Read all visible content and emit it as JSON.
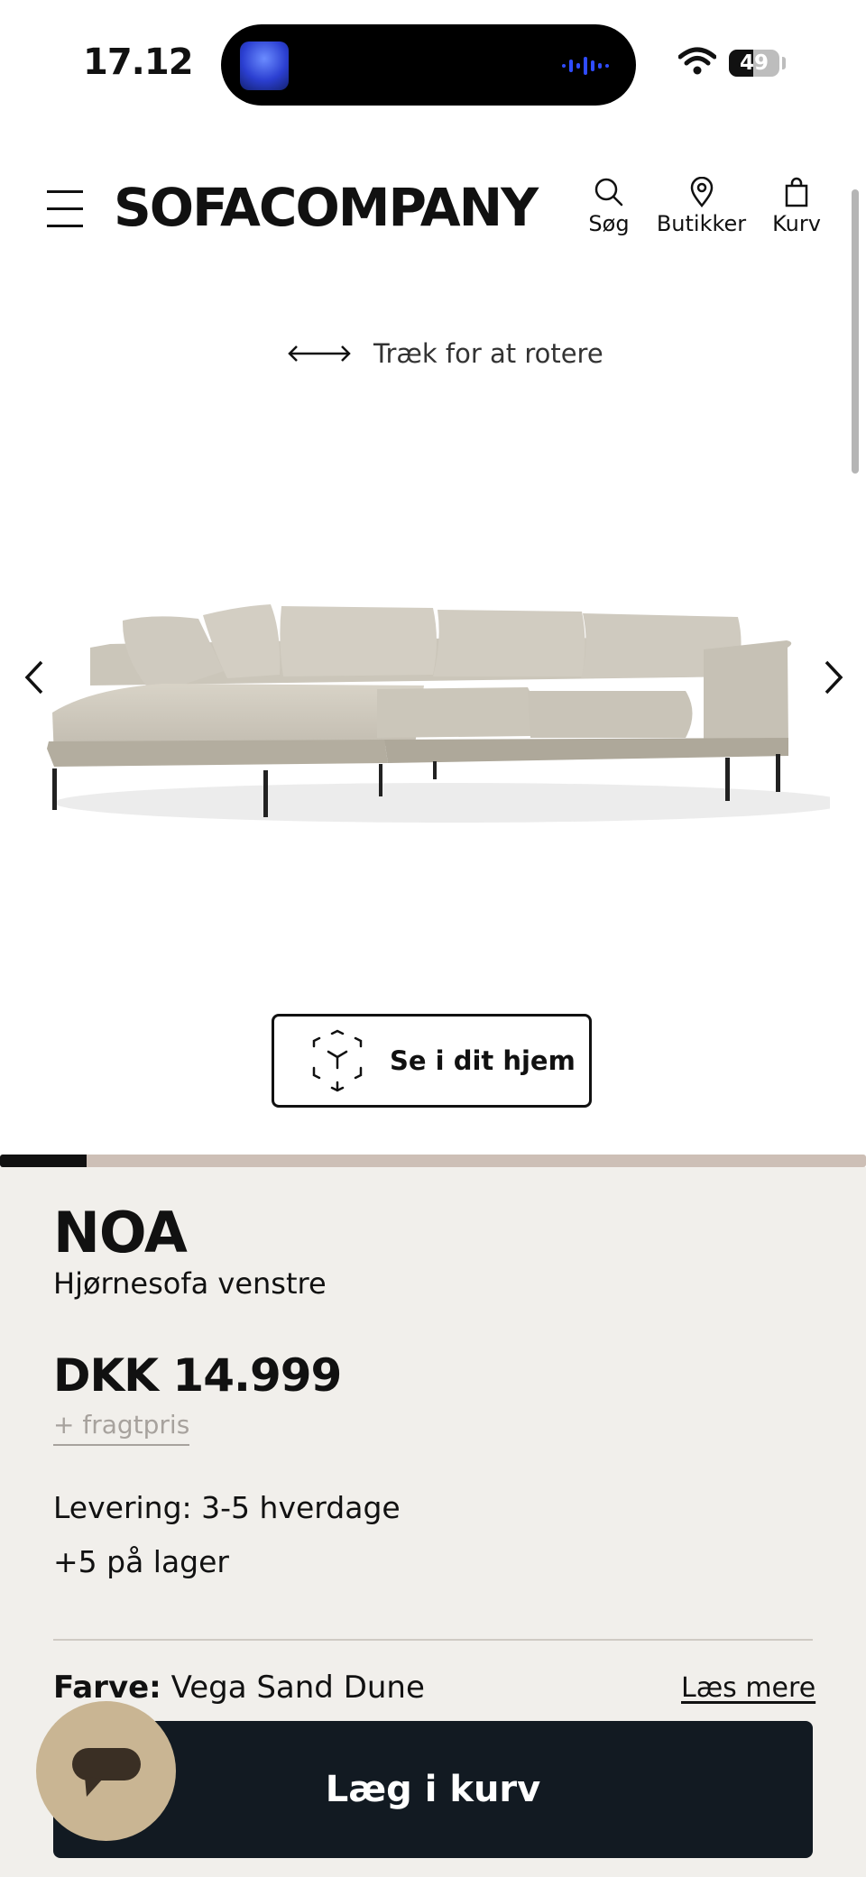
{
  "status_bar": {
    "time": "17.12",
    "battery_level": "49",
    "battery_fraction": 0.49
  },
  "header": {
    "logo": "SOFACOMPANY",
    "search_label": "Søg",
    "stores_label": "Butikker",
    "cart_label": "Kurv"
  },
  "viewer": {
    "rotate_hint": "Træk for at rotere",
    "ar_button_label": "Se i dit hjem",
    "gallery_progress": 0.1
  },
  "product": {
    "name": "NOA",
    "type": "Hjørnesofa venstre",
    "price": "DKK 14.999",
    "shipping_link": "+ fragtpris",
    "delivery": "Levering: 3-5 hverdage",
    "stock": "+5 på lager",
    "color_label": "Farve:",
    "color_value": "Vega Sand Dune",
    "read_more": "Læs mere",
    "add_to_cart": "Læg i kurv"
  },
  "colors": {
    "info_background": "#f1efeb",
    "cart_button": "#121a22",
    "chat_bubble": "#c9b593",
    "progress_track": "#cdbfb6"
  },
  "icons": [
    "menu-icon",
    "search-icon",
    "location-pin-icon",
    "bag-icon",
    "rotate-arrows-icon",
    "chevron-left-icon",
    "chevron-right-icon",
    "ar-cube-icon",
    "chat-icon",
    "wifi-icon",
    "battery-icon"
  ]
}
